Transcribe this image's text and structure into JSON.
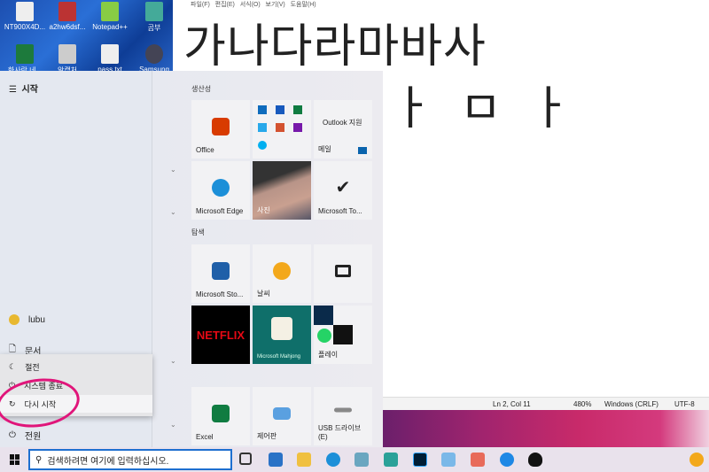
{
  "desktop": {
    "icons": [
      {
        "label": "NT900X4D..."
      },
      {
        "label": "a2hw6dsf..."
      },
      {
        "label": "Notepad++"
      },
      {
        "label": "곰부"
      },
      {
        "label": "한사랑 네..."
      },
      {
        "label": "알캡처"
      },
      {
        "label": "pass.txt"
      },
      {
        "label": "Samsung"
      }
    ]
  },
  "notepad": {
    "menu": "파일(F)   편집(E)   서식(O)   보기(V)   도움말(H)",
    "line1": "가나다라마바사",
    "line2": "ㄷㅏㄹㅏㅁㅏ",
    "status": {
      "position": "Ln 2, Col 11",
      "zoom": "480%",
      "eol": "Windows (CRLF)",
      "encoding": "UTF-8"
    }
  },
  "start": {
    "title": "시작",
    "user": "lubu",
    "documents": "문서",
    "power": "전원",
    "power_menu": [
      {
        "label": "절전"
      },
      {
        "label": "시스템 종료"
      },
      {
        "label": "다시 시작"
      }
    ],
    "sections": {
      "productivity": "생산성",
      "explore": "탐색"
    },
    "tiles": [
      {
        "label": "Office"
      },
      {
        "label": ""
      },
      {
        "label": "Outlook 지원",
        "sub": "메일"
      },
      {
        "label": "Microsoft Edge"
      },
      {
        "label": "사진"
      },
      {
        "label": "Microsoft To..."
      },
      {
        "label": "Microsoft Sto..."
      },
      {
        "label": "날씨"
      },
      {
        "label": ""
      },
      {
        "label": "NETFLIX"
      },
      {
        "label": "Microsoft Mahjong"
      },
      {
        "label": "플레이"
      },
      {
        "label": "Excel"
      },
      {
        "label": "제어판"
      },
      {
        "label": "USB 드라이브 (E)"
      }
    ]
  },
  "taskbar": {
    "search_placeholder": "검색하려면 여기에 입력하십시오."
  }
}
